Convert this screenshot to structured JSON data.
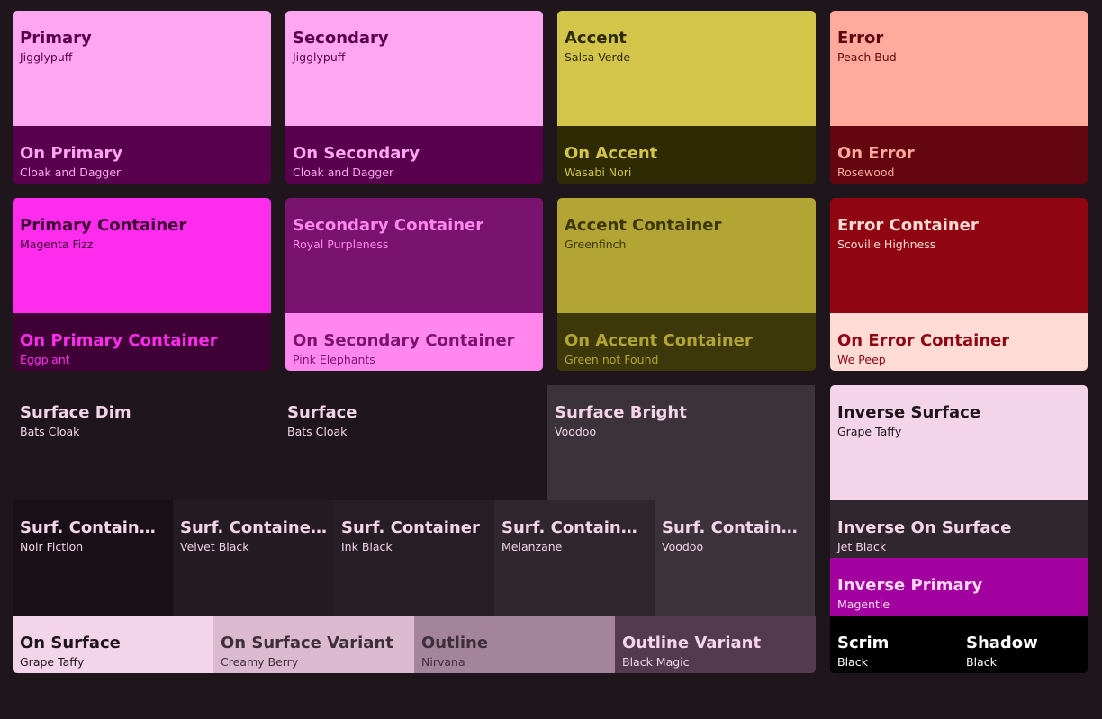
{
  "primary": {
    "name": "Primary",
    "sub": "Jigglypuff",
    "bg": "#ffa6f0",
    "fg": "#58004e"
  },
  "on_primary": {
    "name": "On Primary",
    "sub": "Cloak and Dagger",
    "bg": "#58004e",
    "fg": "#ffa6f0"
  },
  "secondary": {
    "name": "Secondary",
    "sub": "Jigglypuff",
    "bg": "#ffa6f0",
    "fg": "#58004e"
  },
  "on_secondary": {
    "name": "On Secondary",
    "sub": "Cloak and Dagger",
    "bg": "#58004e",
    "fg": "#ffa6f0"
  },
  "accent": {
    "name": "Accent",
    "sub": "Salsa Verde",
    "bg": "#d2c54a",
    "fg": "#2e2b04"
  },
  "on_accent": {
    "name": "On Accent",
    "sub": "Wasabi Nori",
    "bg": "#2e2b04",
    "fg": "#d2c54a"
  },
  "error": {
    "name": "Error",
    "sub": "Peach Bud",
    "bg": "#ffaa9d",
    "fg": "#64060f"
  },
  "on_error": {
    "name": "On Error",
    "sub": "Rosewood",
    "bg": "#64060f",
    "fg": "#ffaa9d"
  },
  "primary_container": {
    "name": "Primary Container",
    "sub": "Magenta Fizz",
    "bg": "#ff2ced",
    "fg": "#3e0035"
  },
  "on_primary_container": {
    "name": "On Primary Container",
    "sub": "Eggplant",
    "bg": "#3e0035",
    "fg": "#ff2ced"
  },
  "secondary_container": {
    "name": "Secondary Container",
    "sub": "Royal Purpleness",
    "bg": "#7a1370",
    "fg": "#ff87ee"
  },
  "on_secondary_container": {
    "name": "On Secondary Container",
    "sub": "Pink Elephants",
    "bg": "#ff87ee",
    "fg": "#7a1370"
  },
  "accent_container": {
    "name": "Accent Container",
    "sub": "Greenfinch",
    "bg": "#b2a534",
    "fg": "#3d380a"
  },
  "on_accent_container": {
    "name": "On Accent Container",
    "sub": "Green not Found",
    "bg": "#3d380a",
    "fg": "#b2a534"
  },
  "error_container": {
    "name": "Error Container",
    "sub": "Scoville Highness",
    "bg": "#8f0612",
    "fg": "#ffdbd6"
  },
  "on_error_container": {
    "name": "On Error Container",
    "sub": "We Peep",
    "bg": "#ffdbd6",
    "fg": "#8f0612"
  },
  "surface_dim": {
    "name": "Surface Dim",
    "sub": "Bats Cloak",
    "bg": "#1e161c",
    "fg": "#f3d4e9"
  },
  "surface": {
    "name": "Surface",
    "sub": "Bats Cloak",
    "bg": "#1e161c",
    "fg": "#f3d4e9"
  },
  "surface_bright": {
    "name": "Surface Bright",
    "sub": "Voodoo",
    "bg": "#3c323a",
    "fg": "#f3d4e9"
  },
  "inverse_surface": {
    "name": "Inverse Surface",
    "sub": "Grape Taffy",
    "bg": "#f3d4e9",
    "fg": "#1e161c"
  },
  "surf_container_lowest": {
    "name": "Surf. Container Lowest",
    "sub": "Noir Fiction",
    "bg": "#181016",
    "fg": "#f3d4e9"
  },
  "surf_container_low": {
    "name": "Surf. Container Low",
    "sub": "Velvet Black",
    "bg": "#241c22",
    "fg": "#f3d4e9"
  },
  "surf_container": {
    "name": "Surf. Container",
    "sub": "Ink Black",
    "bg": "#261e24",
    "fg": "#f3d4e9"
  },
  "surf_container_high": {
    "name": "Surf. Container High",
    "sub": "Melanzane",
    "bg": "#30272e",
    "fg": "#f3d4e9"
  },
  "surf_container_highest": {
    "name": "Surf. Container Highest",
    "sub": "Voodoo",
    "bg": "#3c323a",
    "fg": "#f3d4e9"
  },
  "inverse_on_surface": {
    "name": "Inverse On Surface",
    "sub": "Jet Black",
    "bg": "#30272e",
    "fg": "#f3d4e9"
  },
  "inverse_primary": {
    "name": "Inverse Primary",
    "sub": "Magentle",
    "bg": "#a300a0",
    "fg": "#ffd8f4"
  },
  "on_surface": {
    "name": "On Surface",
    "sub": "Grape Taffy",
    "bg": "#f3d4e9",
    "fg": "#1e161c"
  },
  "on_surface_variant": {
    "name": "On Surface Variant",
    "sub": "Creamy Berry",
    "bg": "#dbbad0",
    "fg": "#3e3039"
  },
  "outline": {
    "name": "Outline",
    "sub": "Nirvana",
    "bg": "#a3849a",
    "fg": "#3e3039"
  },
  "outline_variant": {
    "name": "Outline Variant",
    "sub": "Black Magic",
    "bg": "#533a4c",
    "fg": "#f3d4e9"
  },
  "scrim": {
    "name": "Scrim",
    "sub": "Black",
    "bg": "#000000",
    "fg": "#ffffff"
  },
  "shadow": {
    "name": "Shadow",
    "sub": "Black",
    "bg": "#000000",
    "fg": "#ffffff"
  }
}
